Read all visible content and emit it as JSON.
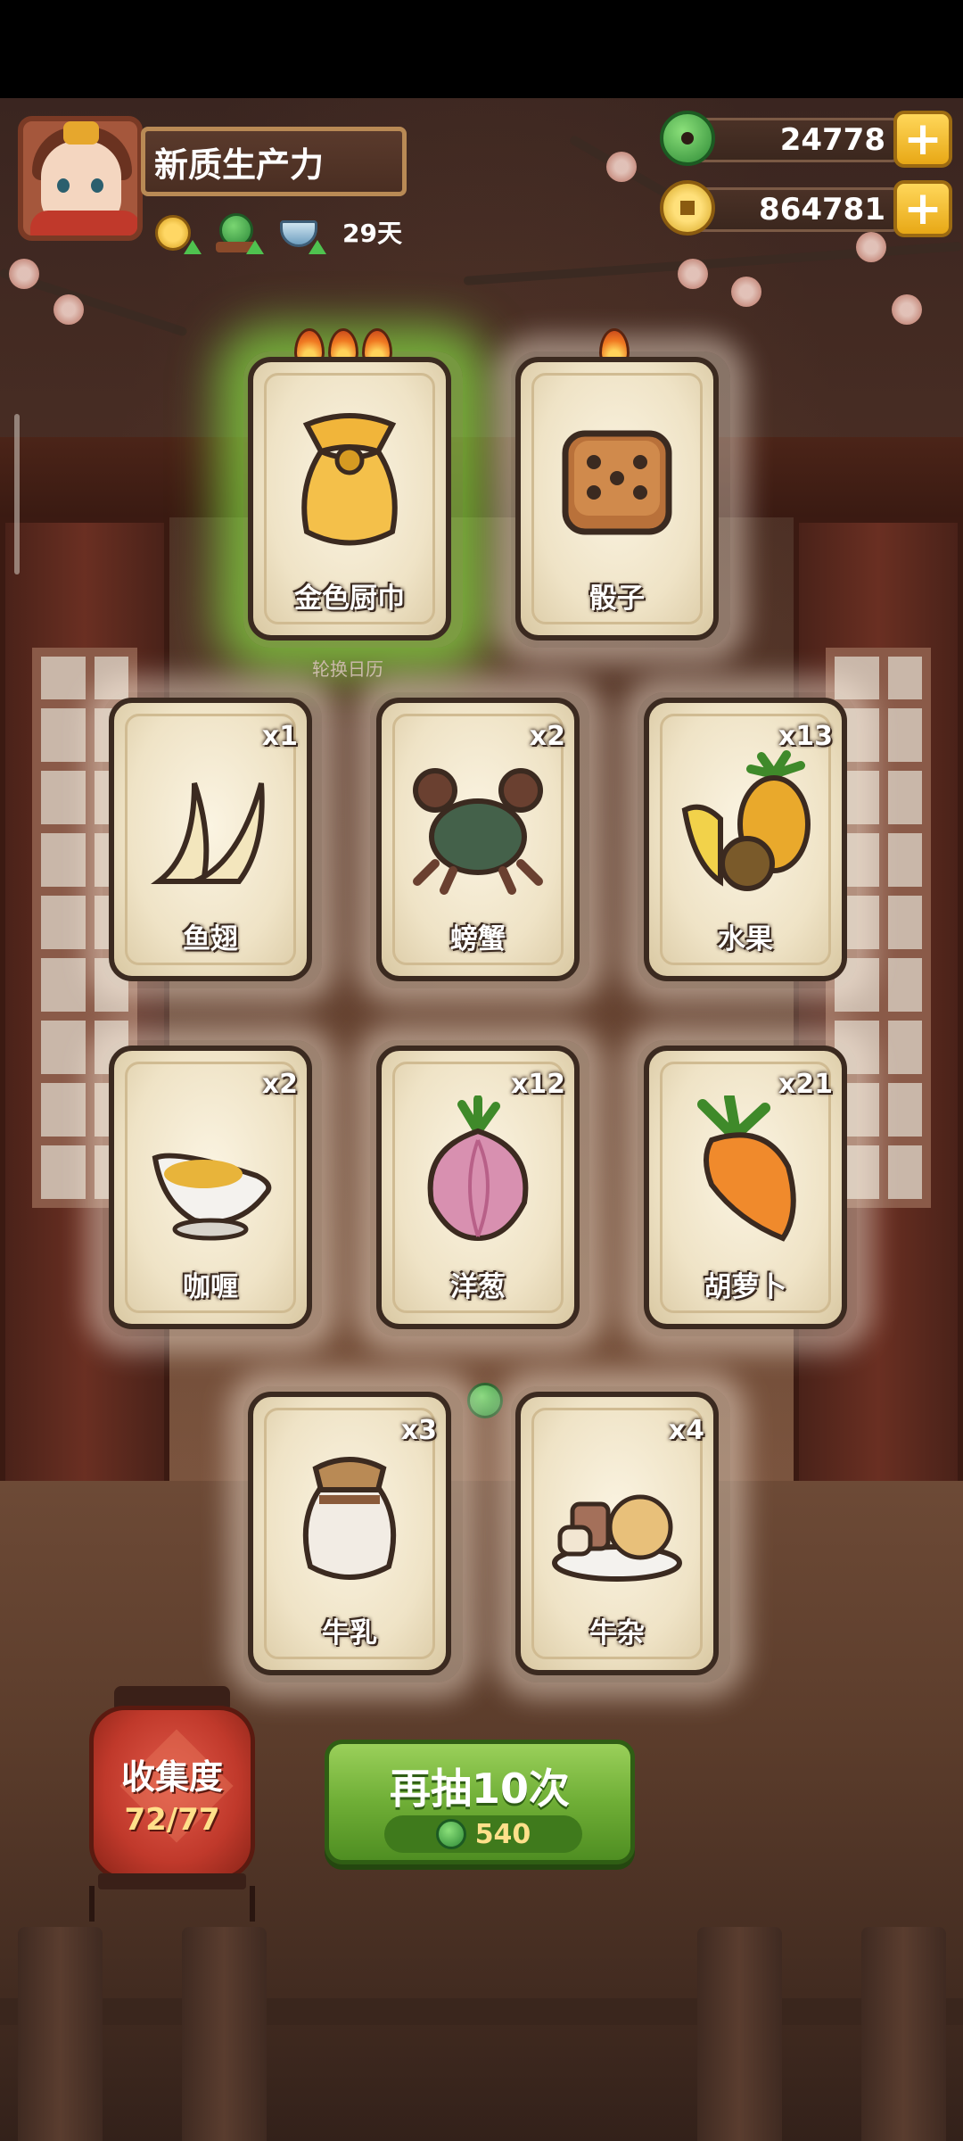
{
  "player": {
    "name": "新质生产力",
    "days": "29天"
  },
  "currency": {
    "jade": "24778",
    "coins": "864781",
    "plus": "+"
  },
  "buffs": [
    "coin-boost-icon",
    "jade-boost-icon",
    "bowl-boost-icon"
  ],
  "featured_cards": [
    {
      "label": "金色厨巾",
      "flames": 3,
      "highlight": true
    },
    {
      "label": "骰子",
      "flames": 1,
      "highlight": false
    }
  ],
  "calendar_label": "轮换日历",
  "cards": [
    {
      "label": "鱼翅",
      "count": "x1"
    },
    {
      "label": "螃蟹",
      "count": "x2"
    },
    {
      "label": "水果",
      "count": "x13"
    },
    {
      "label": "咖喱",
      "count": "x2"
    },
    {
      "label": "洋葱",
      "count": "x12"
    },
    {
      "label": "胡萝卜",
      "count": "x21"
    },
    {
      "label": "牛乳",
      "count": "x3"
    },
    {
      "label": "牛杂",
      "count": "x4"
    }
  ],
  "collection": {
    "title": "收集度",
    "progress": "72/77"
  },
  "draw": {
    "title": "再抽10次",
    "cost": "540"
  },
  "colors": {
    "draw_green": "#6fae36",
    "lantern_red": "#c0392b",
    "gold": "#ffd75a"
  }
}
